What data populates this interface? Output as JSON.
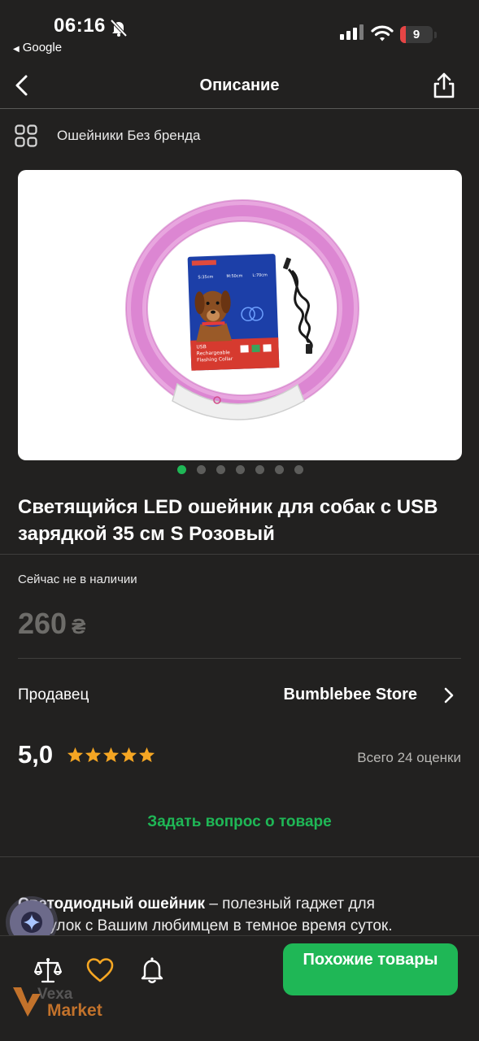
{
  "status_bar": {
    "time": "06:16",
    "back_app": "Google",
    "battery_level": "9"
  },
  "navbar": {
    "title": "Описание"
  },
  "breadcrumb": {
    "text": "Ошейники Без бренда"
  },
  "product_image": {
    "pack_lines": [
      "USB",
      "Rechargeable",
      "Flashing Collar"
    ],
    "sizes": [
      "S:35cm",
      "M:50cm",
      "L:70cm"
    ]
  },
  "gallery": {
    "dot_count": 7,
    "active_index": 0
  },
  "product": {
    "title": "Светящийся LED ошейник для собак с USB зарядкой 35 см S Розовый",
    "availability": "Сейчас не в наличии",
    "price": "260",
    "currency": "₴"
  },
  "seller": {
    "label": "Продавец",
    "name": "Bumblebee Store"
  },
  "rating": {
    "value": "5,0",
    "stars": 5,
    "count_text": "Всего 24 оценки"
  },
  "ask_question": "Задать вопрос о товаре",
  "description": {
    "bold": "Светодиодный ошейник",
    "text": " – полезный гаджет для прогулок с Вашим любимцем в темное время суток."
  },
  "bottom_bar": {
    "similar_button": "Похожие товары"
  },
  "watermark": {
    "line1": "Vexa",
    "line2": "Market"
  },
  "colors": {
    "background": "#222120",
    "accent": "#1fb756",
    "star": "#f5a623",
    "price_muted": "#6d6c69"
  }
}
